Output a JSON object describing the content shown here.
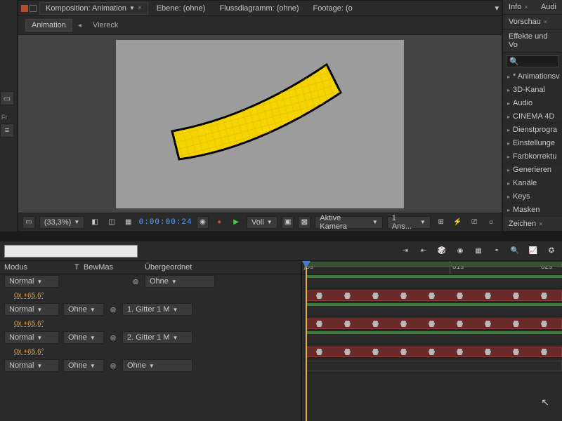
{
  "topTabs": {
    "main": "Komposition: Animation",
    "layer": "Ebene: (ohne)",
    "flow": "Flussdiagramm: (ohne)",
    "footage": "Footage: (o"
  },
  "crumbs": {
    "active": "Animation",
    "parent": "Viereck",
    "fourup": "◫"
  },
  "viewer": {
    "zoom": "(33,3%)",
    "timecode": "0:00:00:24",
    "res": "Voll",
    "camera": "Aktive Kamera",
    "views": "1 Ans..."
  },
  "side": {
    "info": "Info",
    "audio": "Audi",
    "preview": "Vorschau",
    "effects_panel": "Effekte und Vo",
    "search_placeholder": "",
    "fx": [
      "* Animationsv",
      "3D-Kanal",
      "Audio",
      "CINEMA 4D",
      "Dienstprogra",
      "Einstellunge",
      "Farbkorrektu",
      "Generieren",
      "Kanäle",
      "Keys",
      "Masken"
    ],
    "zeichen": "Zeichen"
  },
  "timeline": {
    "head": {
      "modus": "Modus",
      "t": "T",
      "bewmas": "BewMas",
      "parent": "Übergeordnet"
    },
    "dd": {
      "normal": "Normal",
      "ohne": "Ohne",
      "gitter1": "1. Gitter 1 M",
      "gitter2": "2. Gitter 1 M"
    },
    "rotation": "0x +65,6°",
    "ruler": {
      "t0": ")0s",
      "t1": "01s",
      "t2": "02s"
    }
  }
}
